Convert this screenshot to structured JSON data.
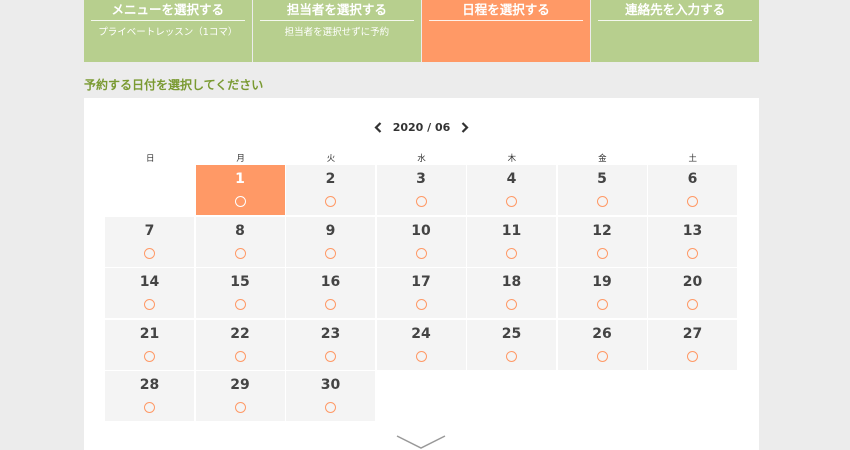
{
  "steps": [
    {
      "title": "メニューを選択する",
      "sub": "プライベートレッスン（1コマ）",
      "active": false
    },
    {
      "title": "担当者を選択する",
      "sub": "担当者を選択せずに予約",
      "active": false
    },
    {
      "title": "日程を選択する",
      "sub": "",
      "active": true
    },
    {
      "title": "連絡先を入力する",
      "sub": "",
      "active": false
    }
  ],
  "section_title": "予約する日付を選択してください",
  "calendar": {
    "month_label": "2020 / 06",
    "weekdays": [
      "日",
      "月",
      "火",
      "水",
      "木",
      "金",
      "土"
    ],
    "leading_blank": 1,
    "days": [
      "1",
      "2",
      "3",
      "4",
      "5",
      "6",
      "7",
      "8",
      "9",
      "10",
      "11",
      "12",
      "13",
      "14",
      "15",
      "16",
      "17",
      "18",
      "19",
      "20",
      "21",
      "22",
      "23",
      "24",
      "25",
      "26",
      "27",
      "28",
      "29",
      "30"
    ],
    "selected_day": "1",
    "availability_symbol": "circle-available-icon"
  },
  "colors": {
    "step_inactive": "#b7cf8e",
    "step_active": "#ff9966",
    "section_title": "#7a9a32",
    "cell_bg": "#f4f4f4",
    "available_circle": "#ff9966"
  }
}
